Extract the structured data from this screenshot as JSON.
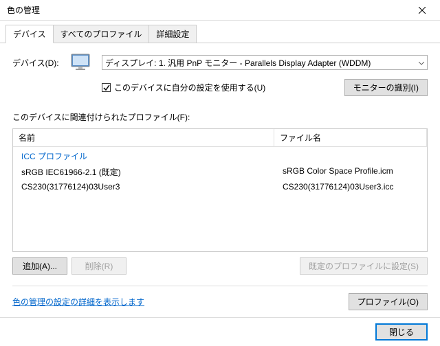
{
  "window": {
    "title": "色の管理"
  },
  "tabs": {
    "t0": "デバイス",
    "t1": "すべてのプロファイル",
    "t2": "詳細設定"
  },
  "device": {
    "label": "デバイス(D):",
    "selected": "ディスプレイ: 1. 汎用 PnP モニター - Parallels Display Adapter (WDDM)",
    "use_settings_label": "このデバイスに自分の設定を使用する(U)",
    "identify_btn": "モニターの識別(I)"
  },
  "profiles": {
    "section_label": "このデバイスに関連付けられたプロファイル(F):",
    "header_name": "名前",
    "header_file": "ファイル名",
    "group_label": "ICC プロファイル",
    "rows": [
      {
        "name": "sRGB IEC61966-2.1 (既定)",
        "file": "sRGB Color Space Profile.icm"
      },
      {
        "name": "CS230(31776124)03User3",
        "file": "CS230(31776124)03User3.icc"
      }
    ]
  },
  "buttons": {
    "add": "追加(A)...",
    "remove": "削除(R)",
    "set_default": "既定のプロファイルに設定(S)",
    "profiles_btn": "プロファイル(O)",
    "details_link": "色の管理の設定の詳細を表示します",
    "close": "閉じる"
  }
}
